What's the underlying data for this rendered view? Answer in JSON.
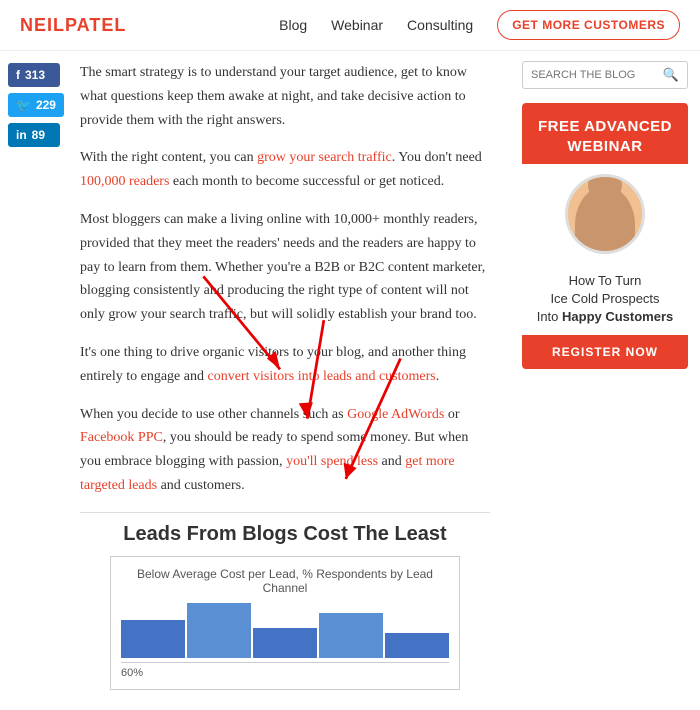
{
  "header": {
    "logo": "NEILPATEL",
    "nav": {
      "blog": "Blog",
      "webinar": "Webinar",
      "consulting": "Consulting"
    },
    "cta": "GET MORE CUSTOMERS"
  },
  "social": {
    "facebook": {
      "label": "f",
      "count": "313"
    },
    "twitter": {
      "label": "✓",
      "count": "229"
    },
    "linkedin": {
      "label": "in",
      "count": "89"
    }
  },
  "article": {
    "para1": "The smart strategy is to understand your target audience, get to know what questions keep them awake at night, and take decisive action to provide them with the right answers.",
    "para2_before": "With the right content, you can ",
    "para2_link1": "grow your search traffic",
    "para2_mid": ". You don't need ",
    "para2_link2": "100,000 readers",
    "para2_after": " each month to become successful or get noticed.",
    "para3": "Most bloggers can make a living online with 10,000+ monthly readers, provided that they meet the readers' needs and the readers are happy to pay to learn from them. Whether you're a B2B or B2C content marketer, blogging consistently and producing the right type of content will not only grow your search traffic, but will solidly establish your brand too.",
    "para4_before": "It's one thing to drive organic visitors to your blog, and another thing entirely to engage and ",
    "para4_link": "convert visitors into leads and customers",
    "para4_after": ".",
    "para5_before": "When you decide to use other channels such as ",
    "para5_link1": "Google AdWords",
    "para5_mid1": " or ",
    "para5_link2": "Facebook PPC",
    "para5_mid2": ", you should be ready to spend some money. But when you embrace blogging with passion, ",
    "para5_link3": "you'll spend less",
    "para5_mid3": " and ",
    "para5_link4": "get more targeted leads",
    "para5_after": " and customers."
  },
  "chart": {
    "title": "Leads From Blogs Cost The Least",
    "subtitle": "Below Average Cost per Lead, % Respondents by Lead Channel",
    "percent_label": "60%"
  },
  "sidebar": {
    "search_placeholder": "SEARCH THE BLOG",
    "webinar_line1": "FREE ADVANCED",
    "webinar_line2": "WEBINAR",
    "webinar_desc_line1": "How To Turn",
    "webinar_desc_line2": "Ice Cold Prospects",
    "webinar_desc_line3": "Into ",
    "webinar_desc_highlight": "Happy Customers",
    "register_btn": "REGISTER NOW"
  }
}
